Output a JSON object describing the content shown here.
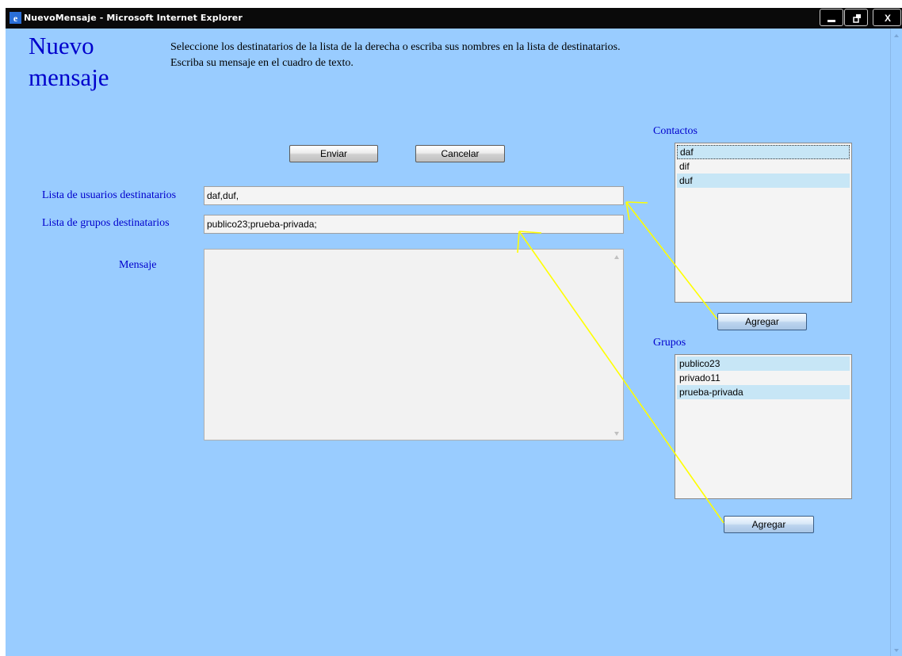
{
  "window": {
    "title": "NuevoMensaje - Microsoft Internet Explorer"
  },
  "header": {
    "title": "Nuevo mensaje",
    "instructions": [
      "Seleccione los destinatarios de la lista de la derecha o escriba sus nombres en la lista de destinatarios.",
      "Escriba su mensaje en el cuadro de texto."
    ]
  },
  "toolbar": {
    "send_label": "Enviar",
    "cancel_label": "Cancelar"
  },
  "form": {
    "users_label": "Lista de usuarios destinatarios",
    "users_value": "daf,duf,",
    "groups_label": "Lista de grupos destinatarios",
    "groups_value": "publico23;prueba-privada;",
    "message_label": "Mensaje",
    "message_value": ""
  },
  "contacts": {
    "title": "Contactos",
    "items": [
      {
        "label": "daf",
        "selected": true,
        "focused": true
      },
      {
        "label": "dif",
        "selected": false
      },
      {
        "label": "duf",
        "selected": true
      }
    ],
    "add_label": "Agregar"
  },
  "groups": {
    "title": "Grupos",
    "items": [
      {
        "label": "publico23",
        "selected": true
      },
      {
        "label": "privado11",
        "selected": false
      },
      {
        "label": "prueba-privada",
        "selected": true
      }
    ],
    "add_label": "Agregar"
  },
  "colors": {
    "background": "#99ccff",
    "heading": "#0000cc",
    "selection": "#c7e6f6",
    "annotation_arrow": "#ffff00",
    "titlebar": "#0a0a0a"
  },
  "icons": [
    "ie-logo-icon",
    "minimize-icon",
    "restore-icon",
    "close-icon",
    "scroll-up-icon",
    "scroll-down-icon"
  ]
}
